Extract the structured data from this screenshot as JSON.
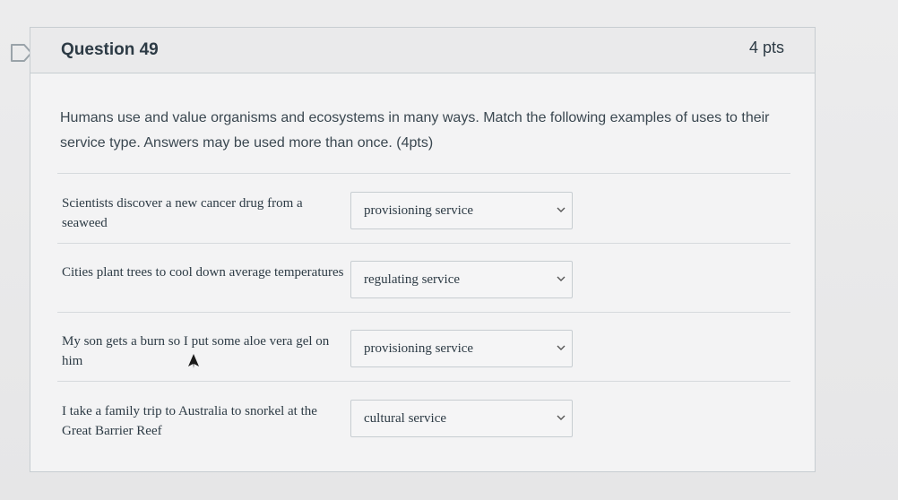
{
  "question": {
    "title": "Question 49",
    "points": "4 pts",
    "text": "Humans use and value organisms and ecosystems in many ways.  Match the following examples of uses to their service type.  Answers may be used more than once. (4pts)"
  },
  "matches": [
    {
      "prompt": "Scientists discover a new cancer drug from a seaweed",
      "selected": "provisioning service"
    },
    {
      "prompt": "Cities plant trees to cool down average temperatures",
      "selected": "regulating service"
    },
    {
      "prompt": "My son gets a burn so I put some aloe vera gel on him",
      "selected": "provisioning service"
    },
    {
      "prompt": "I take a family trip to Australia to snorkel at the Great Barrier Reef",
      "selected": "cultural service"
    }
  ],
  "icons": {
    "flag": "flag-outline-icon",
    "dropdown": "chevron-down-icon",
    "cursor": "mouse-pointer-icon"
  },
  "colors": {
    "text": "#2d3b45",
    "border": "#c7cdd1",
    "background": "#f3f3f4"
  }
}
